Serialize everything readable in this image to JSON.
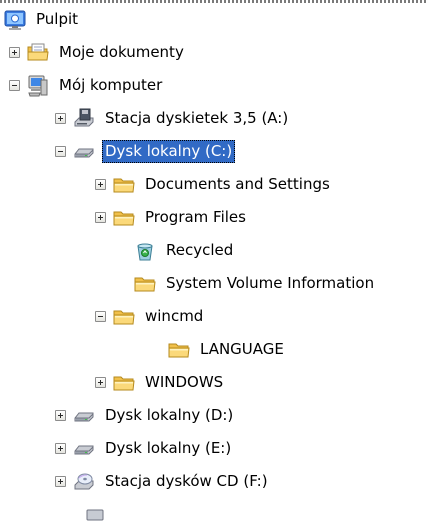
{
  "tree": {
    "desktop": "Pulpit",
    "my_documents": "Moje dokumenty",
    "my_computer": "Mój komputer",
    "floppy": "Stacja dyskietek 3,5 (A:)",
    "drive_c": "Dysk lokalny (C:)",
    "documents_and_settings": "Documents and Settings",
    "program_files": "Program Files",
    "recycled": "Recycled",
    "system_volume_information": "System Volume Information",
    "wincmd": "wincmd",
    "language": "LANGUAGE",
    "windows": "WINDOWS",
    "drive_d": "Dysk lokalny (D:)",
    "drive_e": "Dysk lokalny (E:)",
    "cd_drive": "Stacja dysków CD (F:)"
  },
  "selected_item": "Dysk lokalny (C:)",
  "colors": {
    "selection": "#316ac5",
    "folder": "#f4c84a"
  }
}
